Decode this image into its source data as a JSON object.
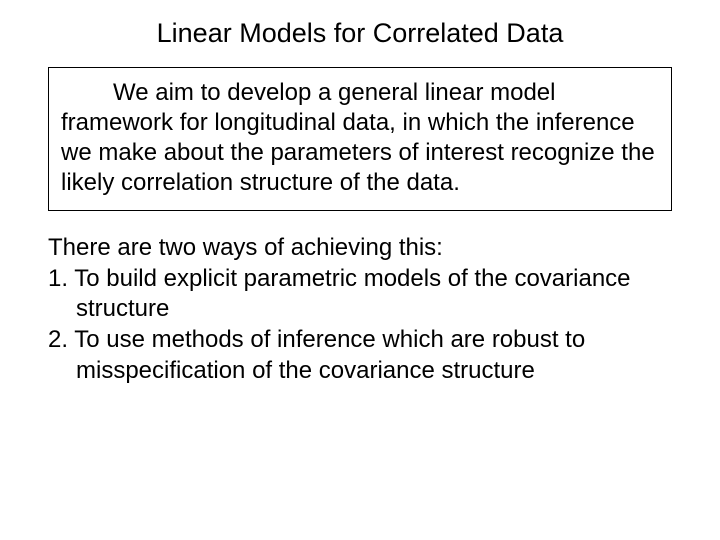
{
  "title": "Linear Models for Correlated Data",
  "box_text": "We aim to develop a general linear model framework for longitudinal data, in which the inference we make about the parameters of interest recognize the likely correlation structure of the data.",
  "intro": "There are two ways of achieving this:",
  "items": [
    "1.  To build explicit parametric models of the covariance structure",
    "2.  To use methods of inference which are robust to misspecification of the covariance structure"
  ]
}
